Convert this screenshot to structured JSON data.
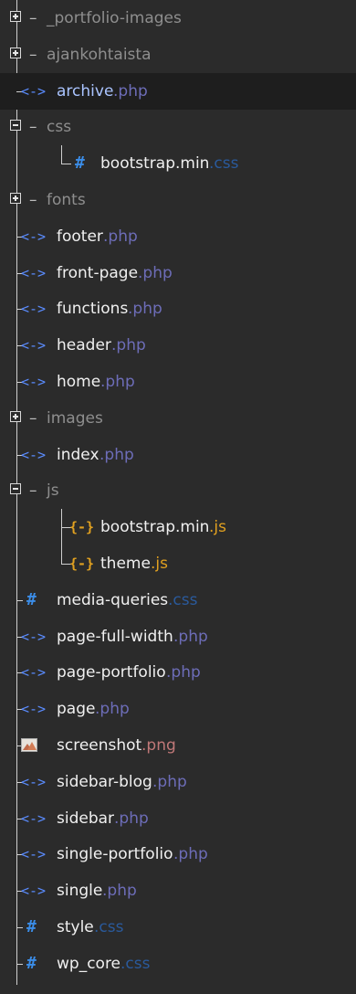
{
  "tree": [
    {
      "type": "folder",
      "name": "_portfolio-images",
      "expanded": false,
      "depth": 0
    },
    {
      "type": "folder",
      "name": "ajankohtaista",
      "expanded": false,
      "depth": 0
    },
    {
      "type": "file",
      "name": "archive",
      "ext": ".php",
      "icon": "php-file-icon",
      "selected": true,
      "depth": 0
    },
    {
      "type": "folder",
      "name": "css",
      "expanded": true,
      "depth": 0
    },
    {
      "type": "file",
      "name": "bootstrap.min",
      "ext": ".css",
      "icon": "css-file-icon",
      "depth": 1
    },
    {
      "type": "folder",
      "name": "fonts",
      "expanded": false,
      "depth": 0
    },
    {
      "type": "file",
      "name": "footer",
      "ext": ".php",
      "icon": "php-file-icon",
      "depth": 0
    },
    {
      "type": "file",
      "name": "front-page",
      "ext": ".php",
      "icon": "php-file-icon",
      "depth": 0
    },
    {
      "type": "file",
      "name": "functions",
      "ext": ".php",
      "icon": "php-file-icon",
      "depth": 0
    },
    {
      "type": "file",
      "name": "header",
      "ext": ".php",
      "icon": "php-file-icon",
      "depth": 0
    },
    {
      "type": "file",
      "name": "home",
      "ext": ".php",
      "icon": "php-file-icon",
      "depth": 0
    },
    {
      "type": "folder",
      "name": "images",
      "expanded": false,
      "depth": 0
    },
    {
      "type": "file",
      "name": "index",
      "ext": ".php",
      "icon": "php-file-icon",
      "depth": 0
    },
    {
      "type": "folder",
      "name": "js",
      "expanded": true,
      "depth": 0
    },
    {
      "type": "file",
      "name": "bootstrap.min",
      "ext": ".js",
      "icon": "js-file-icon",
      "depth": 1
    },
    {
      "type": "file",
      "name": "theme",
      "ext": ".js",
      "icon": "js-file-icon",
      "depth": 1
    },
    {
      "type": "file",
      "name": "media-queries",
      "ext": ".css",
      "icon": "css-file-icon",
      "depth": 0
    },
    {
      "type": "file",
      "name": "page-full-width",
      "ext": ".php",
      "icon": "php-file-icon",
      "depth": 0
    },
    {
      "type": "file",
      "name": "page-portfolio",
      "ext": ".php",
      "icon": "php-file-icon",
      "depth": 0
    },
    {
      "type": "file",
      "name": "page",
      "ext": ".php",
      "icon": "php-file-icon",
      "depth": 0
    },
    {
      "type": "file",
      "name": "screenshot",
      "ext": ".png",
      "icon": "image-file-icon",
      "depth": 0
    },
    {
      "type": "file",
      "name": "sidebar-blog",
      "ext": ".php",
      "icon": "php-file-icon",
      "depth": 0
    },
    {
      "type": "file",
      "name": "sidebar",
      "ext": ".php",
      "icon": "php-file-icon",
      "depth": 0
    },
    {
      "type": "file",
      "name": "single-portfolio",
      "ext": ".php",
      "icon": "php-file-icon",
      "depth": 0
    },
    {
      "type": "file",
      "name": "single",
      "ext": ".php",
      "icon": "php-file-icon",
      "depth": 0
    },
    {
      "type": "file",
      "name": "style",
      "ext": ".css",
      "icon": "css-file-icon",
      "depth": 0
    },
    {
      "type": "file",
      "name": "wp_core",
      "ext": ".css",
      "icon": "css-file-icon",
      "depth": 0
    }
  ],
  "glyphs": {
    "php-file-icon": "<·>",
    "css-file-icon": "#",
    "js-file-icon": "{·}",
    "folder-dash": "–"
  },
  "colors": {
    "background": "#2b2b2b",
    "selected_row": "#1e1e1e",
    "php_ext": "#6d6db8",
    "css_ext": "#2a5a9c",
    "js_ext": "#e0a020",
    "png_ext": "#c07878"
  }
}
